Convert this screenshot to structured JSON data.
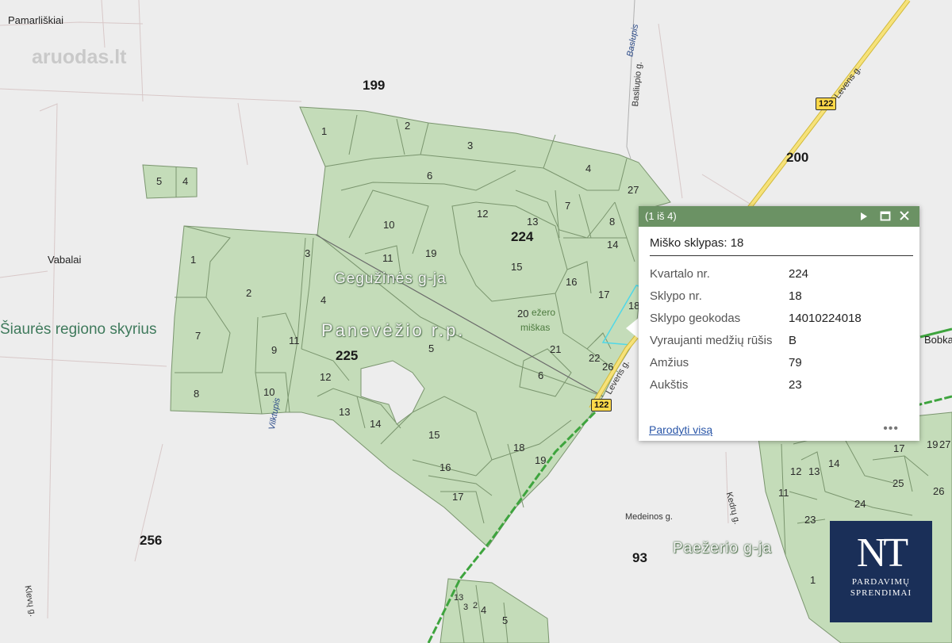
{
  "map": {
    "watermark": "aruodas.lt",
    "place_labels": [
      {
        "text": "Pamarliškiai",
        "cls": "place"
      },
      {
        "text": "Vabalai",
        "cls": "place"
      },
      {
        "text": "Bobka",
        "cls": "place"
      }
    ],
    "quarter_numbers": [
      "199",
      "200",
      "224",
      "225",
      "256",
      "93"
    ],
    "street_labels": [
      {
        "text": "Basliupio g."
      },
      {
        "text": "Levens g."
      },
      {
        "text": "Kedrų g."
      },
      {
        "text": "Medeinos g."
      },
      {
        "text": "Klevų g."
      }
    ],
    "water_labels": [
      "Baslupis",
      "Vilktupis"
    ],
    "region_label": "Šiaurės regiono skyrius",
    "admin_labels": {
      "geguzines": "Gegužinės g-ja",
      "panevezio": "Panevėžio r.p.",
      "paezerio": "Paežerio g-ja",
      "forest_a": "ežero",
      "forest_b": "miškas"
    },
    "road_number": "122",
    "parcel_numbers": [
      "1",
      "2",
      "3",
      "4",
      "5",
      "6",
      "7",
      "8",
      "10",
      "11",
      "12",
      "13",
      "14",
      "15",
      "16",
      "17",
      "18",
      "19",
      "20",
      "21",
      "22",
      "26",
      "27",
      "1",
      "2",
      "3",
      "4",
      "5",
      "6",
      "7",
      "8",
      "9",
      "10",
      "11",
      "12",
      "13",
      "14",
      "15",
      "16",
      "17",
      "18",
      "19",
      "5",
      "4",
      "12",
      "13",
      "14",
      "11",
      "23",
      "24",
      "25",
      "26",
      "17",
      "19",
      "27",
      "1",
      "13",
      "3",
      "2",
      "4",
      "5"
    ]
  },
  "popup": {
    "counter": "(1 iš 4)",
    "title": "Miško sklypas: 18",
    "fields": [
      {
        "key": "Kvartalo nr.",
        "value": "224"
      },
      {
        "key": "Sklypo nr.",
        "value": "18"
      },
      {
        "key": "Sklypo geokodas",
        "value": "14010224018"
      },
      {
        "key": "Vyraujanti medžių rūšis",
        "value": "B"
      },
      {
        "key": "Amžius",
        "value": "79"
      },
      {
        "key": "Aukštis",
        "value": "23"
      }
    ],
    "show_all_link": "Parodyti visą",
    "more_label": "•••"
  },
  "logo": {
    "mark": "NT",
    "line1": "PARDAVIMŲ",
    "line2": "SPRENDIMAI"
  },
  "colors": {
    "forest_fill": "#c4dcb9",
    "parcel_line": "#77926c",
    "road_yellow": "#f2dc5c",
    "road_green": "#4aa84a",
    "popup_header": "#6b9264",
    "logo_bg": "#1a2f58"
  }
}
